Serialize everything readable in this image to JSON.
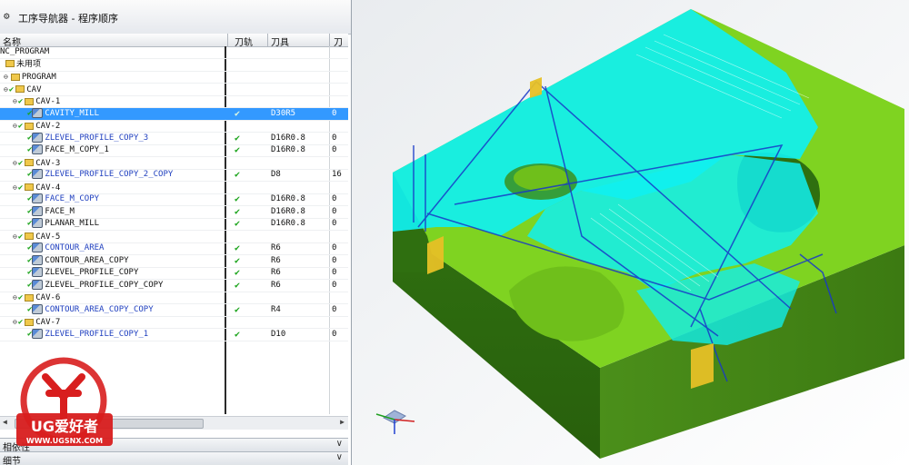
{
  "window": {
    "title": "工序导航器 - 程序顺序"
  },
  "columns": {
    "name": "名称",
    "toolpath": "刀轨",
    "tool": "刀具",
    "path": "刀"
  },
  "rows": [
    {
      "label": "NC_PROGRAM",
      "tool": "",
      "path": "",
      "check": ""
    },
    {
      "label": "未用项",
      "tool": "",
      "path": "",
      "check": ""
    },
    {
      "label": "PROGRAM",
      "tool": "",
      "path": "",
      "check": ""
    },
    {
      "label": "CAV",
      "tool": "",
      "path": "",
      "check": ""
    },
    {
      "label": "CAV-1",
      "tool": "",
      "path": "",
      "check": ""
    },
    {
      "label": "CAVITY_MILL",
      "tool": "D30R5",
      "path": "0",
      "check": "✔"
    },
    {
      "label": "CAV-2",
      "tool": "",
      "path": "",
      "check": ""
    },
    {
      "label": "ZLEVEL_PROFILE_COPY_3",
      "tool": "D16R0.8",
      "path": "0",
      "check": "✔"
    },
    {
      "label": "FACE_M_COPY_1",
      "tool": "D16R0.8",
      "path": "0",
      "check": "✔"
    },
    {
      "label": "CAV-3",
      "tool": "",
      "path": "",
      "check": ""
    },
    {
      "label": "ZLEVEL_PROFILE_COPY_2_COPY",
      "tool": "D8",
      "path": "16",
      "check": "✔"
    },
    {
      "label": "CAV-4",
      "tool": "",
      "path": "",
      "check": ""
    },
    {
      "label": "FACE_M_COPY",
      "tool": "D16R0.8",
      "path": "0",
      "check": "✔"
    },
    {
      "label": "FACE_M",
      "tool": "D16R0.8",
      "path": "0",
      "check": "✔"
    },
    {
      "label": "PLANAR_MILL",
      "tool": "D16R0.8",
      "path": "0",
      "check": "✔"
    },
    {
      "label": "CAV-5",
      "tool": "",
      "path": "",
      "check": ""
    },
    {
      "label": "CONTOUR_AREA",
      "tool": "R6",
      "path": "0",
      "check": "✔"
    },
    {
      "label": "CONTOUR_AREA_COPY",
      "tool": "R6",
      "path": "0",
      "check": "✔"
    },
    {
      "label": "ZLEVEL_PROFILE_COPY",
      "tool": "R6",
      "path": "0",
      "check": "✔"
    },
    {
      "label": "ZLEVEL_PROFILE_COPY_COPY",
      "tool": "R6",
      "path": "0",
      "check": "✔"
    },
    {
      "label": "CAV-6",
      "tool": "",
      "path": "",
      "check": ""
    },
    {
      "label": "CONTOUR_AREA_COPY_COPY",
      "tool": "R4",
      "path": "0",
      "check": "✔"
    },
    {
      "label": "CAV-7",
      "tool": "",
      "path": "",
      "check": ""
    },
    {
      "label": "ZLEVEL_PROFILE_COPY_1",
      "tool": "D10",
      "path": "0",
      "check": "✔"
    }
  ],
  "panels": {
    "dependencies": "相依性",
    "details": "细节"
  },
  "watermark": {
    "brand": "UG爱好者",
    "url": "WWW.UGSNX.COM"
  },
  "colors": {
    "selection": "#3399ff",
    "model_green": "#7fd321",
    "toolpath_cyan": "#10f0f0",
    "edge_blue": "#1838c8"
  }
}
